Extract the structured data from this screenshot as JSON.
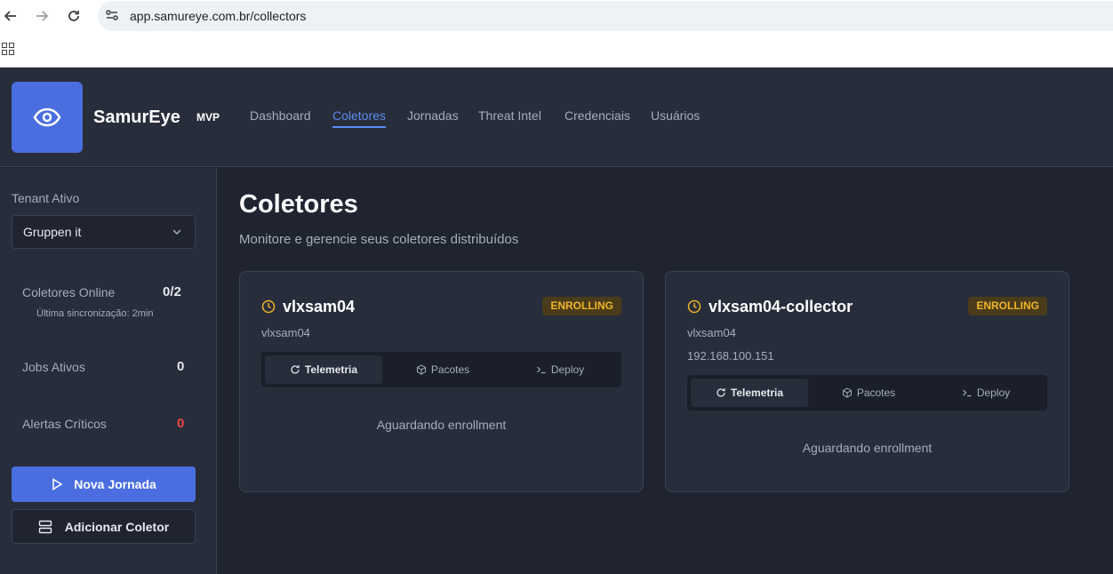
{
  "browser": {
    "url": "app.samureye.com.br/collectors"
  },
  "header": {
    "brand": "SamurEye",
    "badge": "MVP",
    "nav": [
      {
        "label": "Dashboard"
      },
      {
        "label": "Coletores"
      },
      {
        "label": "Jornadas"
      },
      {
        "label": "Threat Intel"
      },
      {
        "label": "Credenciais"
      },
      {
        "label": "Usuários"
      }
    ],
    "active_nav": "Coletores"
  },
  "sidebar": {
    "tenant_label": "Tenant Ativo",
    "tenant_value": "Gruppen it",
    "stats": [
      {
        "label": "Coletores Online",
        "value": "0/2",
        "sub": "Última sincronização: 2min"
      },
      {
        "label": "Jobs Ativos",
        "value": "0"
      },
      {
        "label": "Alertas Críticos",
        "value": "0"
      }
    ],
    "primary_button": "Nova Jornada",
    "secondary_button": "Adicionar Coletor"
  },
  "main": {
    "title": "Coletores",
    "subtitle": "Monitore e gerencie seus coletores distribuídos",
    "collectors": [
      {
        "name": "vlxsam04",
        "status": "ENROLLING",
        "host": "vlxsam04",
        "ip": "",
        "tabs": [
          "Telemetria",
          "Pacotes",
          "Deploy"
        ],
        "message": "Aguardando enrollment"
      },
      {
        "name": "vlxsam04-collector",
        "status": "ENROLLING",
        "host": "vlxsam04",
        "ip": "192.168.100.151",
        "tabs": [
          "Telemetria",
          "Pacotes",
          "Deploy"
        ],
        "message": "Aguardando enrollment"
      }
    ]
  },
  "colors": {
    "accent": "#4a6ee0",
    "nav_active": "#5b8cf0",
    "status_enrolling": "#f0b429",
    "critical": "#ef4444"
  }
}
